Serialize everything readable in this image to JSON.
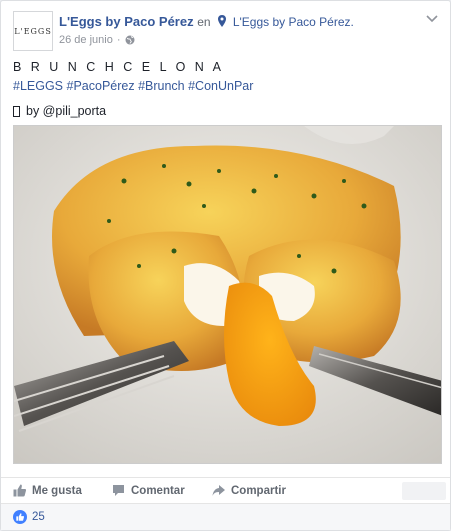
{
  "post": {
    "avatar_text": "L'EGGS",
    "page_name": "L'Eggs by Paco Pérez",
    "connector": "en",
    "location": "L'Eggs by Paco Pérez.",
    "date": "26 de junio",
    "icons": {
      "location": "location-pin-icon",
      "privacy": "globe-icon",
      "menu": "chevron-down-icon"
    }
  },
  "content": {
    "title": "B R U N C H C E L O N A",
    "hashtags": "#LEGGS #PacoPérez #Brunch #ConUnPar",
    "credit": "by @pili_porta"
  },
  "actions": {
    "like": "Me gusta",
    "comment": "Comentar",
    "share": "Compartir"
  },
  "reactions": {
    "count": "25",
    "accent": "#4080ff"
  }
}
